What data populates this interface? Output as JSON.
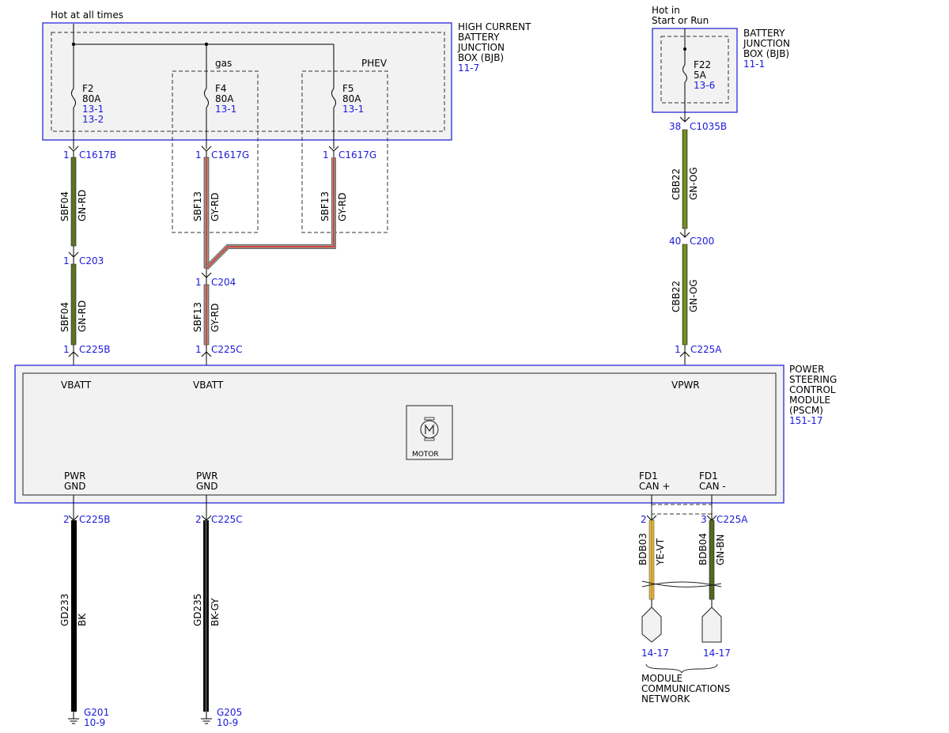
{
  "labels": {
    "hot_all_times": "Hot at all times",
    "hot_start_run_1": "Hot in",
    "hot_start_run_2": "Start or Run",
    "gas": "gas",
    "phev": "PHEV"
  },
  "hcbjb": {
    "l1": "HIGH CURRENT",
    "l2": "BATTERY",
    "l3": "JUNCTION",
    "l4": "BOX (BJB)",
    "ref": "11-7"
  },
  "bjb": {
    "l1": "BATTERY",
    "l2": "JUNCTION",
    "l3": "BOX (BJB)",
    "ref": "11-1"
  },
  "pscm": {
    "l1": "POWER",
    "l2": "STEERING",
    "l3": "CONTROL",
    "l4": "MODULE",
    "l5": "(PSCM)",
    "ref": "151-17",
    "motor": "MOTOR"
  },
  "fuses": {
    "f2": {
      "name": "F2",
      "amp": "80A",
      "ref1": "13-1",
      "ref2": "13-2"
    },
    "f4": {
      "name": "F4",
      "amp": "80A",
      "ref1": "13-1"
    },
    "f5": {
      "name": "F5",
      "amp": "80A",
      "ref1": "13-1"
    },
    "f22": {
      "name": "F22",
      "amp": "5A",
      "ref1": "13-6"
    }
  },
  "connectors": {
    "c1617b": {
      "pin": "1",
      "name": "C1617B"
    },
    "c1617g_a": {
      "pin": "1",
      "name": "C1617G"
    },
    "c1617g_b": {
      "pin": "1",
      "name": "C1617G"
    },
    "c203": {
      "pin": "1",
      "name": "C203"
    },
    "c204": {
      "pin": "1",
      "name": "C204"
    },
    "c225b_top": {
      "pin": "1",
      "name": "C225B"
    },
    "c225c_top": {
      "pin": "1",
      "name": "C225C"
    },
    "c1035b": {
      "pin": "38",
      "name": "C1035B"
    },
    "c200": {
      "pin": "40",
      "name": "C200"
    },
    "c225a_top": {
      "pin": "1",
      "name": "C225A"
    },
    "c225b_bot": {
      "pin": "2",
      "name": "C225B"
    },
    "c225c_bot": {
      "pin": "2",
      "name": "C225C"
    },
    "c225a_can_p": {
      "pin": "2"
    },
    "c225a_can_m": {
      "pin": "3",
      "name": "C225A"
    }
  },
  "wires": {
    "w1": {
      "circuit": "SBF04",
      "color": "GN-RD"
    },
    "w2": {
      "circuit": "SBF04",
      "color": "GN-RD"
    },
    "w3": {
      "circuit": "SBF13",
      "color": "GY-RD"
    },
    "w4": {
      "circuit": "SBF13",
      "color": "GY-RD"
    },
    "w5": {
      "circuit": "SBF13",
      "color": "GY-RD"
    },
    "w6": {
      "circuit": "CBB22",
      "color": "GN-OG"
    },
    "w7": {
      "circuit": "CBB22",
      "color": "GN-OG"
    },
    "w8": {
      "circuit": "GD233",
      "color": "BK"
    },
    "w9": {
      "circuit": "GD235",
      "color": "BK-GY"
    },
    "w10": {
      "circuit": "BDB03",
      "color": "YE-VT"
    },
    "w11": {
      "circuit": "BDB04",
      "color": "GN-BN"
    }
  },
  "pins": {
    "vbatt1": "VBATT",
    "vbatt2": "VBATT",
    "vpwr": "VPWR",
    "pwr_gnd1_a": "PWR",
    "pwr_gnd1_b": "GND",
    "pwr_gnd2_a": "PWR",
    "pwr_gnd2_b": "GND",
    "fd1_canp_a": "FD1",
    "fd1_canp_b": "CAN +",
    "fd1_canm_a": "FD1",
    "fd1_canm_b": "CAN -"
  },
  "grounds": {
    "g201": {
      "name": "G201",
      "ref": "10-9"
    },
    "g205": {
      "name": "G205",
      "ref": "10-9"
    }
  },
  "network": {
    "ref_a": "14-17",
    "ref_b": "14-17",
    "l1": "MODULE",
    "l2": "COMMUNICATIONS",
    "l3": "NETWORK"
  },
  "colors": {
    "gn_rd_core": "#4a7a1e",
    "gy_rd_core": "#b55a50",
    "gn_og_core": "#5a8a1e",
    "ye_vt_core": "#e8c020",
    "gn_bn_core": "#4a6a1e",
    "outline_blue": "#2a2ad8",
    "text_blue": "#1a1adb"
  }
}
